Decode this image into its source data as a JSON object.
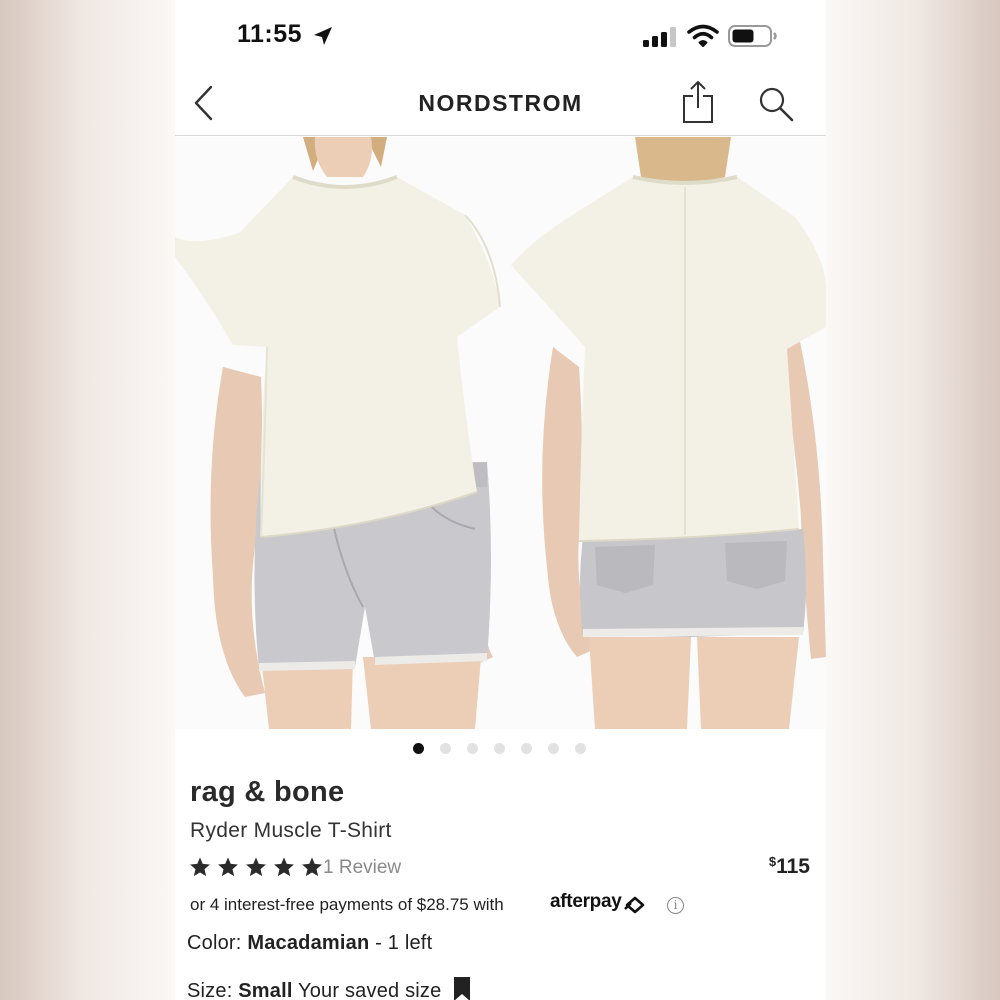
{
  "status_bar": {
    "time": "11:55",
    "icons": [
      "location-arrow-icon",
      "cellular-signal-icon",
      "wifi-icon",
      "battery-icon"
    ]
  },
  "nav": {
    "brand": "NORDSTROM",
    "icons": [
      "back-chevron-icon",
      "share-icon",
      "search-icon"
    ]
  },
  "carousel": {
    "total": 7,
    "active_index": 0
  },
  "product": {
    "brand": "rag & bone",
    "title": "Ryder Muscle T-Shirt",
    "rating": 5,
    "max_rating": 5,
    "review_text": "1 Review",
    "price_symbol": "$",
    "price_amount": "115",
    "installments_text": "or 4 interest-free payments of $28.75 with",
    "afterpay_label": "afterpay",
    "info_symbol": "i",
    "color_label": "Color:",
    "color_value": "Macadamian",
    "color_stock": " - 1 left",
    "size_label": "Size:",
    "size_value": "Small",
    "size_note": "Your saved size"
  },
  "colors": {
    "text_dark": "#222222",
    "review_gray": "#8a8a8a",
    "dot_active": "#111111",
    "dot_inactive": "#e2e2e2",
    "shirt": "#f3f1e6",
    "denim": "#c9c9cd",
    "skin": "#e8c9b4"
  }
}
